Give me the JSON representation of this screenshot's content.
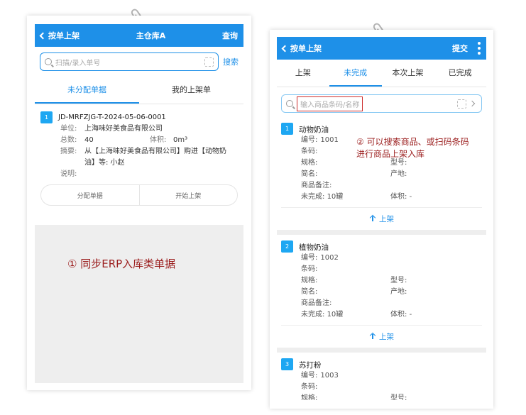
{
  "left": {
    "header": {
      "back_label": "按单上架",
      "title": "主仓库A",
      "action": "查询"
    },
    "search": {
      "placeholder": "扫描/录入单号",
      "button": "搜索"
    },
    "tabs": [
      {
        "label": "未分配单据",
        "active": true
      },
      {
        "label": "我的上架单",
        "active": false
      }
    ],
    "order": {
      "index": "1",
      "number": "JD-MRFZJG-T-2024-05-06-0001",
      "unit_label": "单位:",
      "unit": "上海味好美食品有限公司",
      "total_label": "总数:",
      "total": "40",
      "volume_label": "体积:",
      "volume": "0m³",
      "summary_label": "摘要:",
      "summary_line1": "从【上海味好美食品有限公司】购进【动物奶",
      "summary_line2": "油】等: 小赵",
      "note_label": "说明:",
      "note": ""
    },
    "buttons": {
      "assign": "分配单据",
      "start": "开始上架"
    },
    "annotation": "① 同步ERP入库类单据"
  },
  "right": {
    "header": {
      "back_label": "按单上架",
      "action": "提交"
    },
    "tabs": [
      {
        "label": "上架",
        "active": false
      },
      {
        "label": "未完成",
        "active": true
      },
      {
        "label": "本次上架",
        "active": false
      },
      {
        "label": "已完成",
        "active": false
      }
    ],
    "search": {
      "placeholder": "输入商品条码/名称"
    },
    "annotation_line1": "② 可以搜索商品、或扫码条码",
    "annotation_line2": "进行商品上架入库",
    "labels": {
      "code": "编号:",
      "barcode": "条码:",
      "spec": "规格:",
      "model": "型号:",
      "short": "简名:",
      "origin": "产地:",
      "remark": "商品备注:",
      "unfinished": "未完成:",
      "volume": "体积:"
    },
    "up_label": "上架",
    "goods": [
      {
        "index": "1",
        "name": "动物奶油",
        "code": "1001",
        "unfinished": "10罐",
        "volume": "-"
      },
      {
        "index": "2",
        "name": "植物奶油",
        "code": "1002",
        "unfinished": "10罐",
        "volume": "-"
      },
      {
        "index": "3",
        "name": "苏打粉",
        "code": "1003",
        "unfinished": "",
        "volume": ""
      }
    ]
  },
  "colors": {
    "accent": "#1e90e8",
    "annotation": "#9b1d1d",
    "highlight_box": "#cc2b2b"
  }
}
